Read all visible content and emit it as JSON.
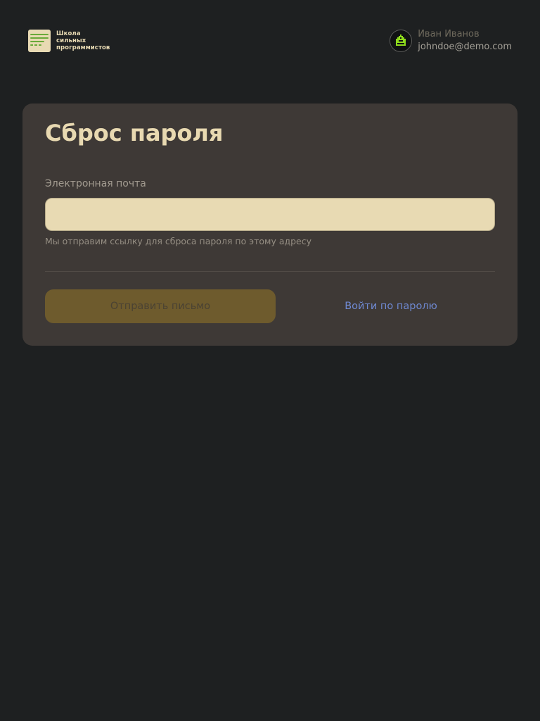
{
  "header": {
    "logo": {
      "icon": "school-logo-icon",
      "lines": [
        "Школа",
        "сильных",
        "программистов"
      ]
    },
    "user": {
      "avatar_icon": "pixel-avatar-icon",
      "name": "Иван Иванов",
      "email": "johndoe@demo.com"
    }
  },
  "form": {
    "title": "Сброс пароля",
    "email_label": "Электронная почта",
    "email_value": "",
    "email_hint": "Мы отправим ссылку для сброса пароля по этому адресу",
    "submit_label": "Отправить письмо",
    "password_login_label": "Войти по паролю"
  },
  "colors": {
    "background": "#1e2021",
    "card": "#3e3936",
    "accent_text": "#e8d9b1",
    "input_background": "#e8dab3",
    "button_disabled": "#6e5b2d",
    "link": "#6f89d2",
    "logo_green": "#6aaa3a",
    "avatar_green": "#8edb1c"
  }
}
